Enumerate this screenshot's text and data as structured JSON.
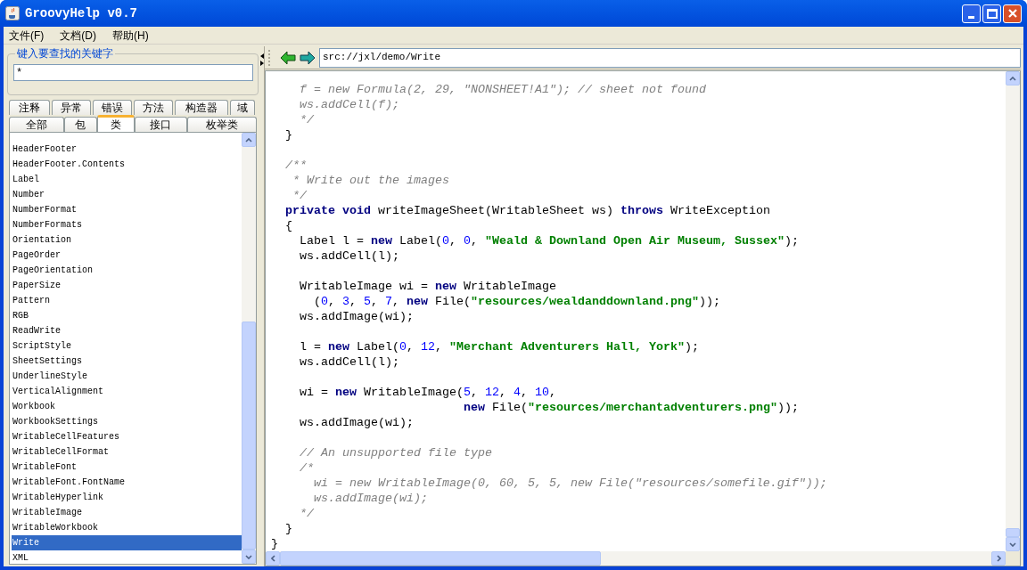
{
  "window": {
    "title": "GroovyHelp v0.7"
  },
  "menu": [
    {
      "label": "文件(F)"
    },
    {
      "label": "文档(D)"
    },
    {
      "label": "帮助(H)"
    }
  ],
  "search": {
    "legend": "键入要查找的关键字",
    "value": "*"
  },
  "tabs_row_1": [
    {
      "label": "注释",
      "selected": false
    },
    {
      "label": "异常",
      "selected": false
    },
    {
      "label": "错误",
      "selected": false
    },
    {
      "label": "方法",
      "selected": false
    },
    {
      "label": "构造器",
      "selected": false
    },
    {
      "label": "域",
      "selected": false
    }
  ],
  "tabs_row_2": [
    {
      "label": "全部",
      "selected": false
    },
    {
      "label": "包",
      "selected": false
    },
    {
      "label": "类",
      "selected": true
    },
    {
      "label": "接口",
      "selected": false
    },
    {
      "label": "枚举类",
      "selected": false
    }
  ],
  "class_list": [
    {
      "label": "HeaderFooter",
      "selected": false
    },
    {
      "label": "HeaderFooter.Contents",
      "selected": false
    },
    {
      "label": "Label",
      "selected": false
    },
    {
      "label": "Number",
      "selected": false
    },
    {
      "label": "NumberFormat",
      "selected": false
    },
    {
      "label": "NumberFormats",
      "selected": false
    },
    {
      "label": "Orientation",
      "selected": false
    },
    {
      "label": "PageOrder",
      "selected": false
    },
    {
      "label": "PageOrientation",
      "selected": false
    },
    {
      "label": "PaperSize",
      "selected": false
    },
    {
      "label": "Pattern",
      "selected": false
    },
    {
      "label": "RGB",
      "selected": false
    },
    {
      "label": "ReadWrite",
      "selected": false
    },
    {
      "label": "ScriptStyle",
      "selected": false
    },
    {
      "label": "SheetSettings",
      "selected": false
    },
    {
      "label": "UnderlineStyle",
      "selected": false
    },
    {
      "label": "VerticalAlignment",
      "selected": false
    },
    {
      "label": "Workbook",
      "selected": false
    },
    {
      "label": "WorkbookSettings",
      "selected": false
    },
    {
      "label": "WritableCellFeatures",
      "selected": false
    },
    {
      "label": "WritableCellFormat",
      "selected": false
    },
    {
      "label": "WritableFont",
      "selected": false
    },
    {
      "label": "WritableFont.FontName",
      "selected": false
    },
    {
      "label": "WritableHyperlink",
      "selected": false
    },
    {
      "label": "WritableImage",
      "selected": false
    },
    {
      "label": "WritableWorkbook",
      "selected": false
    },
    {
      "label": "Write",
      "selected": true
    },
    {
      "label": "XML",
      "selected": false
    }
  ],
  "address": "src://jxl/demo/Write",
  "code_lines": [
    {
      "kind": "code",
      "tokens": [
        {
          "kind": "comment",
          "text": "    f = new Formula(2, 29, \"NONSHEET!A1\"); // sheet not found"
        }
      ]
    },
    {
      "kind": "code",
      "tokens": [
        {
          "kind": "comment",
          "text": "    ws.addCell(f);"
        }
      ]
    },
    {
      "kind": "code",
      "tokens": [
        {
          "kind": "comment",
          "text": "    */"
        }
      ]
    },
    {
      "kind": "code",
      "tokens": [
        {
          "kind": "plain",
          "text": "  }"
        }
      ]
    },
    {
      "kind": "blank"
    },
    {
      "kind": "code",
      "tokens": [
        {
          "kind": "comment",
          "text": "  /**"
        }
      ]
    },
    {
      "kind": "code",
      "tokens": [
        {
          "kind": "comment",
          "text": "   * Write out the images"
        }
      ]
    },
    {
      "kind": "code",
      "tokens": [
        {
          "kind": "comment",
          "text": "   */"
        }
      ]
    },
    {
      "kind": "code",
      "tokens": [
        {
          "kind": "keyword",
          "text": "  private void"
        },
        {
          "kind": "plain",
          "text": " writeImageSheet(WritableSheet ws) "
        },
        {
          "kind": "keyword",
          "text": "throws"
        },
        {
          "kind": "plain",
          "text": " WriteException"
        }
      ]
    },
    {
      "kind": "code",
      "tokens": [
        {
          "kind": "plain",
          "text": "  {"
        }
      ]
    },
    {
      "kind": "code",
      "tokens": [
        {
          "kind": "plain",
          "text": "    Label l = "
        },
        {
          "kind": "keyword",
          "text": "new"
        },
        {
          "kind": "plain",
          "text": " Label("
        },
        {
          "kind": "number",
          "text": "0"
        },
        {
          "kind": "plain",
          "text": ", "
        },
        {
          "kind": "number",
          "text": "0"
        },
        {
          "kind": "plain",
          "text": ", "
        },
        {
          "kind": "string",
          "text": "\"Weald & Downland Open Air Museum, Sussex\""
        },
        {
          "kind": "plain",
          "text": ");"
        }
      ]
    },
    {
      "kind": "code",
      "tokens": [
        {
          "kind": "plain",
          "text": "    ws.addCell(l);"
        }
      ]
    },
    {
      "kind": "blank"
    },
    {
      "kind": "code",
      "tokens": [
        {
          "kind": "plain",
          "text": "    WritableImage wi = "
        },
        {
          "kind": "keyword",
          "text": "new"
        },
        {
          "kind": "plain",
          "text": " WritableImage"
        }
      ]
    },
    {
      "kind": "code",
      "tokens": [
        {
          "kind": "plain",
          "text": "      ("
        },
        {
          "kind": "number",
          "text": "0"
        },
        {
          "kind": "plain",
          "text": ", "
        },
        {
          "kind": "number",
          "text": "3"
        },
        {
          "kind": "plain",
          "text": ", "
        },
        {
          "kind": "number",
          "text": "5"
        },
        {
          "kind": "plain",
          "text": ", "
        },
        {
          "kind": "number",
          "text": "7"
        },
        {
          "kind": "plain",
          "text": ", "
        },
        {
          "kind": "keyword",
          "text": "new"
        },
        {
          "kind": "plain",
          "text": " File("
        },
        {
          "kind": "string",
          "text": "\"resources/wealdanddownland.png\""
        },
        {
          "kind": "plain",
          "text": "));"
        }
      ]
    },
    {
      "kind": "code",
      "tokens": [
        {
          "kind": "plain",
          "text": "    ws.addImage(wi);"
        }
      ]
    },
    {
      "kind": "blank"
    },
    {
      "kind": "code",
      "tokens": [
        {
          "kind": "plain",
          "text": "    l = "
        },
        {
          "kind": "keyword",
          "text": "new"
        },
        {
          "kind": "plain",
          "text": " Label("
        },
        {
          "kind": "number",
          "text": "0"
        },
        {
          "kind": "plain",
          "text": ", "
        },
        {
          "kind": "number",
          "text": "12"
        },
        {
          "kind": "plain",
          "text": ", "
        },
        {
          "kind": "string",
          "text": "\"Merchant Adventurers Hall, York\""
        },
        {
          "kind": "plain",
          "text": ");"
        }
      ]
    },
    {
      "kind": "code",
      "tokens": [
        {
          "kind": "plain",
          "text": "    ws.addCell(l);"
        }
      ]
    },
    {
      "kind": "blank"
    },
    {
      "kind": "code",
      "tokens": [
        {
          "kind": "plain",
          "text": "    wi = "
        },
        {
          "kind": "keyword",
          "text": "new"
        },
        {
          "kind": "plain",
          "text": " WritableImage("
        },
        {
          "kind": "number",
          "text": "5"
        },
        {
          "kind": "plain",
          "text": ", "
        },
        {
          "kind": "number",
          "text": "12"
        },
        {
          "kind": "plain",
          "text": ", "
        },
        {
          "kind": "number",
          "text": "4"
        },
        {
          "kind": "plain",
          "text": ", "
        },
        {
          "kind": "number",
          "text": "10"
        },
        {
          "kind": "plain",
          "text": ","
        }
      ]
    },
    {
      "kind": "code",
      "tokens": [
        {
          "kind": "keyword",
          "text": "                           new"
        },
        {
          "kind": "plain",
          "text": " File("
        },
        {
          "kind": "string",
          "text": "\"resources/merchantadventurers.png\""
        },
        {
          "kind": "plain",
          "text": "));"
        }
      ]
    },
    {
      "kind": "code",
      "tokens": [
        {
          "kind": "plain",
          "text": "    ws.addImage(wi);"
        }
      ]
    },
    {
      "kind": "blank"
    },
    {
      "kind": "code",
      "tokens": [
        {
          "kind": "comment",
          "text": "    // An unsupported file type"
        }
      ]
    },
    {
      "kind": "code",
      "tokens": [
        {
          "kind": "comment",
          "text": "    /*"
        }
      ]
    },
    {
      "kind": "code",
      "tokens": [
        {
          "kind": "comment",
          "text": "      wi = new WritableImage(0, 60, 5, 5, new File(\"resources/somefile.gif\"));"
        }
      ]
    },
    {
      "kind": "code",
      "tokens": [
        {
          "kind": "comment",
          "text": "      ws.addImage(wi);"
        }
      ]
    },
    {
      "kind": "code",
      "tokens": [
        {
          "kind": "comment",
          "text": "    */"
        }
      ]
    },
    {
      "kind": "code",
      "tokens": [
        {
          "kind": "plain",
          "text": "  }"
        }
      ]
    },
    {
      "kind": "code",
      "tokens": [
        {
          "kind": "plain",
          "text": "}"
        }
      ]
    }
  ]
}
